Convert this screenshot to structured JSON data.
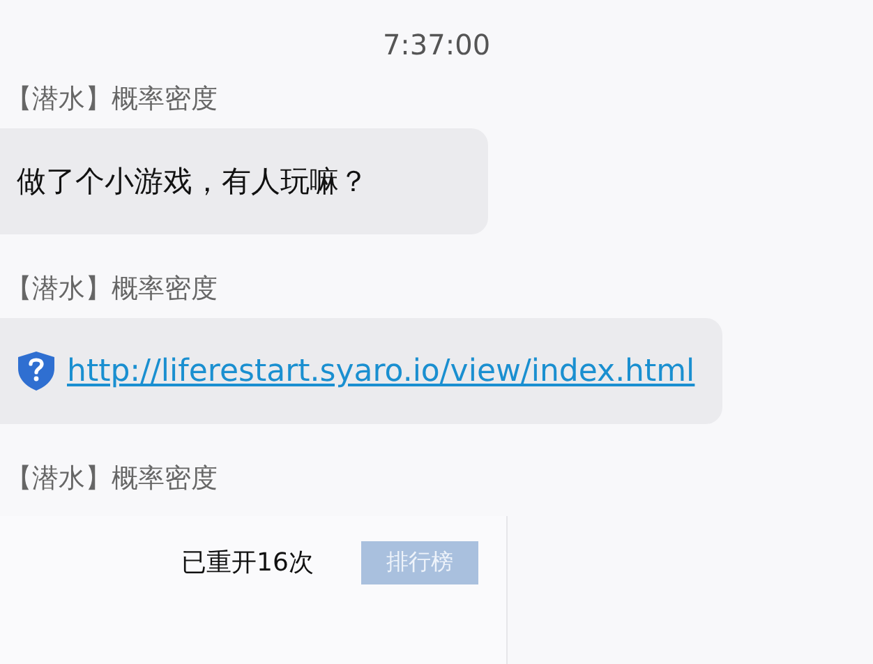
{
  "timestamp": "7:37:00",
  "messages": [
    {
      "sender": "【潜水】概率密度",
      "kind": "text",
      "text": "做了个小游戏，有人玩嘛？"
    },
    {
      "sender": "【潜水】概率密度",
      "kind": "link",
      "text": "http://liferestart.syaro.io/view/index.html"
    },
    {
      "sender": "【潜水】概率密度",
      "kind": "card",
      "text": "已重开16次",
      "button": {
        "label": "排行榜",
        "disabled": true
      }
    }
  ]
}
